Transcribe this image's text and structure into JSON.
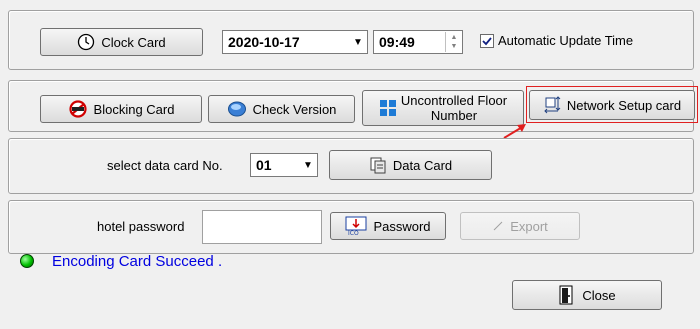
{
  "clock": {
    "clock_card_label": "Clock Card",
    "date_value": "2020-10-17",
    "time_value": "09:49",
    "auto_update_label": "Automatic Update Time",
    "auto_update_checked": true
  },
  "actions": {
    "blocking_card_label": "Blocking Card",
    "check_version_label": "Check Version",
    "uncontrolled_floor_line1": "Uncontrolled Floor",
    "uncontrolled_floor_line2": "Number",
    "network_setup_label": "Network Setup card"
  },
  "data_card": {
    "select_label": "select data card No.",
    "card_no_value": "01",
    "data_card_label": "Data Card"
  },
  "hotel": {
    "password_label": "hotel password",
    "password_value": "",
    "password_button_label": "Password",
    "export_label": "Export"
  },
  "status": {
    "message": "Encoding Card Succeed .",
    "indicator_color": "#00c000",
    "message_color": "#0000e0"
  },
  "footer": {
    "close_label": "Close"
  },
  "highlight": {
    "color": "#e02020"
  }
}
